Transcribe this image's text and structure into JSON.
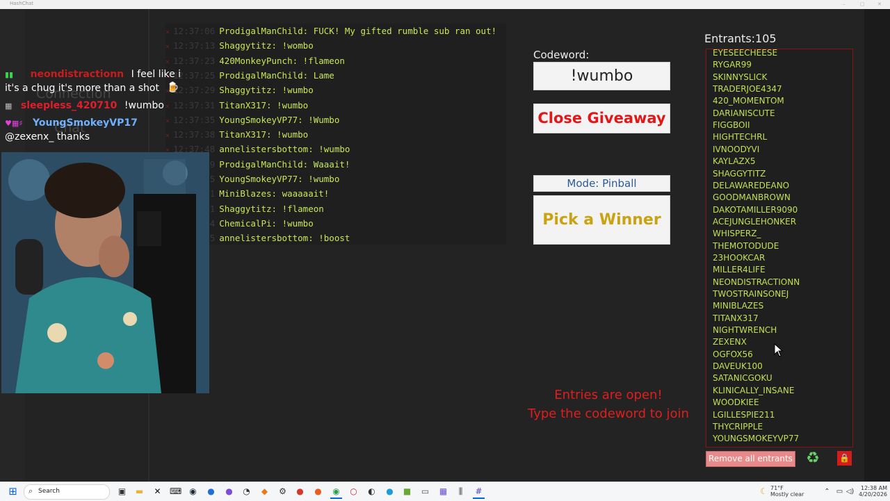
{
  "window": {
    "title": "HashChat"
  },
  "chat_log": [
    {
      "time": "12:37:06",
      "user": "ProdigalManChild",
      "msg": "FUCK! My gifted rumble sub ran out!"
    },
    {
      "time": "12:37:13",
      "user": "Shaggytitz",
      "msg": "!wombo"
    },
    {
      "time": "12:37:23",
      "user": "420MonkeyPunch",
      "msg": "!flameon"
    },
    {
      "time": "12:37:25",
      "user": "ProdigalManChild",
      "msg": "Lame"
    },
    {
      "time": "12:37:29",
      "user": "Shaggytitz",
      "msg": "!wumbo"
    },
    {
      "time": "12:37:31",
      "user": "TitanX317",
      "msg": "!wumbo"
    },
    {
      "time": "12:37:35",
      "user": "YoungSmokeyVP77",
      "msg": "!Wumbo"
    },
    {
      "time": "12:37:38",
      "user": "TitanX317",
      "msg": "!wumbo"
    },
    {
      "time": "12:37:48",
      "user": "annelistersbottom",
      "msg": "!wumbo"
    },
    {
      "time": "12:37:49",
      "user": "ProdigalManChild",
      "msg": "Waaait!"
    },
    {
      "time": "12:37:55",
      "user": "YoungSmokeyVP77",
      "msg": "!wumbo"
    },
    {
      "time": "12:38:01",
      "user": "MiniBlazes",
      "msg": "waaaaait!"
    },
    {
      "time": "12:38:01",
      "user": "Shaggytitz",
      "msg": "!flameon"
    },
    {
      "time": "12:38:04",
      "user": "ChemicalPi",
      "msg": "!wumbo"
    },
    {
      "time": "12:38:05",
      "user": "annelistersbottom",
      "msg": "!boost"
    }
  ],
  "stream_overlay": {
    "line1_user": "neondistractionn",
    "line1_text": "I feel like i",
    "line2_text": "it's a chug it's more than a shot",
    "line3_user": "sleepless_420710",
    "line3_text": "!wumbo",
    "line4_user": "YoungSmokeyVP17",
    "line5_text": "@zexenx_ thanks",
    "faint_connection": "Connection",
    "faint_chat": "Chat"
  },
  "giveaway": {
    "codeword_label": "Codeword:",
    "codeword_value": "!wumbo",
    "close_button": "Close Giveaway",
    "mode_label": "Mode: Pinball",
    "pick_button": "Pick a Winner",
    "status_line1": "Entries are open!",
    "status_line2": "Type the codeword to join"
  },
  "entrants": {
    "header": "Entrants:105",
    "names": [
      "EYESEECHEESE",
      "RYGAR99",
      "SKINNYSLICK",
      "TRADERJOE4347",
      "420_MOMENTOM",
      "DARIANISCUTE",
      "FIGGBOII",
      "HIGHTECHRL",
      "IVNOODYVI",
      "KAYLAZX5",
      "SHAGGYTITZ",
      "DELAWAREDEANO",
      "GOODMANBROWN",
      "DAKOTAMILLER9090",
      "ACEJUNGLEHONKER",
      "WHISPERZ_",
      "THEMOTODUDE",
      "23HOOKCAR",
      "MILLER4LIFE",
      "NEONDISTRACTIONN",
      "TWOSTRAINSONEJ",
      "MINIBLAZES",
      "TITANX317",
      "NIGHTWRENCH",
      "ZEXENX",
      "OGFOX56",
      "DAVEUK100",
      "SATANICGOKU",
      "KLINICALLY_INSANE",
      "WOODKIEE",
      "LGILLESPIE211",
      "THYCRIPPLE",
      "YOUNGSMOKEYVP77"
    ],
    "remove_all": "Remove all entrants",
    "recycle_icon": "recycle-icon",
    "lock_icon": "lock-icon"
  },
  "taskbar": {
    "search_placeholder": "Search",
    "weather_temp": "71°F",
    "weather_desc": "Mostly clear",
    "time": "12:38 AM",
    "date": "4/20/2026"
  },
  "colors": {
    "chat_text": "#c8e65a",
    "entrant_text": "#bfe058",
    "danger": "#e11818",
    "mode_text": "#2a5a98",
    "pick_text": "#c9a311"
  }
}
